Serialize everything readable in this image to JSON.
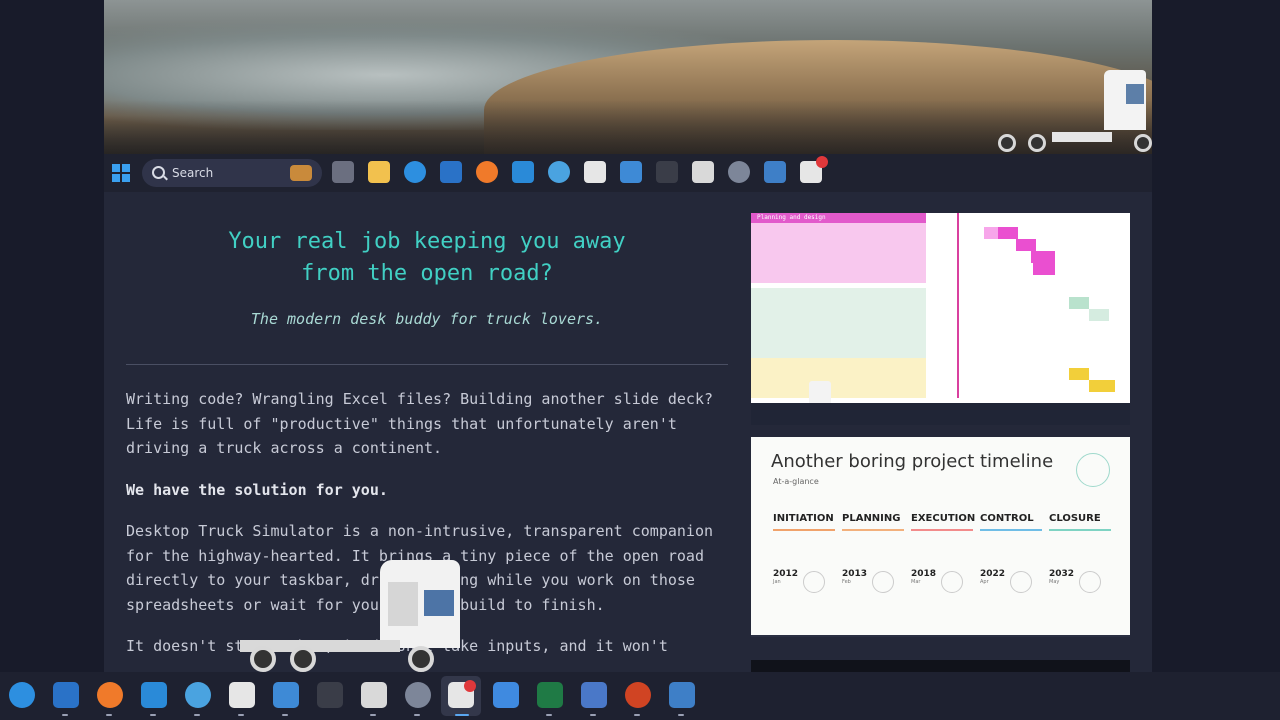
{
  "inner_taskbar": {
    "search_placeholder": "Search",
    "icons": [
      "task-view-icon",
      "file-explorer-icon",
      "edge-icon",
      "outlook-icon",
      "firefox-icon",
      "vscode-icon",
      "tuba-icon",
      "tootle-icon",
      "image-viewer-icon",
      "terminal-icon",
      "snipping-tool-icon",
      "settings-icon",
      "network-icon",
      "desktop-truck-icon"
    ]
  },
  "content": {
    "heading_line1": "Your real job keeping you away",
    "heading_line2": "from the open road?",
    "tagline": "The modern desk buddy for truck lovers.",
    "para1": "Writing code? Wrangling Excel files? Building another slide deck? Life is full of \"productive\" things that unfortunately aren't driving a truck across a continent.",
    "para2": "We have the solution for you.",
    "para3": "Desktop Truck Simulator is a non-intrusive, transparent companion for the highway-hearted. It brings a tiny piece of the open road directly to your taskbar, driving along while you work on those spreadsheets or wait for your latest build to finish.",
    "para4": "It doesn't steer. Thus, it doesn't take inputs, and it won't"
  },
  "screenshot1": {
    "section_label": "Planning and design"
  },
  "screenshot2": {
    "title": "Another boring project timeline",
    "subtitle": "At-a-glance",
    "phases": [
      {
        "name": "INITIATION",
        "year": "2012",
        "month": "Jan",
        "color": "#f0a26b"
      },
      {
        "name": "PLANNING",
        "year": "2013",
        "month": "Feb",
        "color": "#f2b07c"
      },
      {
        "name": "EXECUTION",
        "year": "2018",
        "month": "Mar",
        "color": "#f28b8b"
      },
      {
        "name": "CONTROL",
        "year": "2022",
        "month": "Apr",
        "color": "#6fbde6"
      },
      {
        "name": "CLOSURE",
        "year": "2032",
        "month": "May",
        "color": "#7ed3c3"
      }
    ]
  },
  "taskbar": {
    "apps": [
      "edge-icon",
      "outlook-icon",
      "firefox-icon",
      "vscode-icon",
      "tuba-icon",
      "tootle-icon",
      "image-viewer-icon",
      "terminal-icon",
      "snipping-tool-icon",
      "settings-icon",
      "desktop-truck-icon",
      "paint-icon",
      "excel-icon",
      "discord-icon",
      "powerpoint-icon",
      "network-icon"
    ]
  }
}
